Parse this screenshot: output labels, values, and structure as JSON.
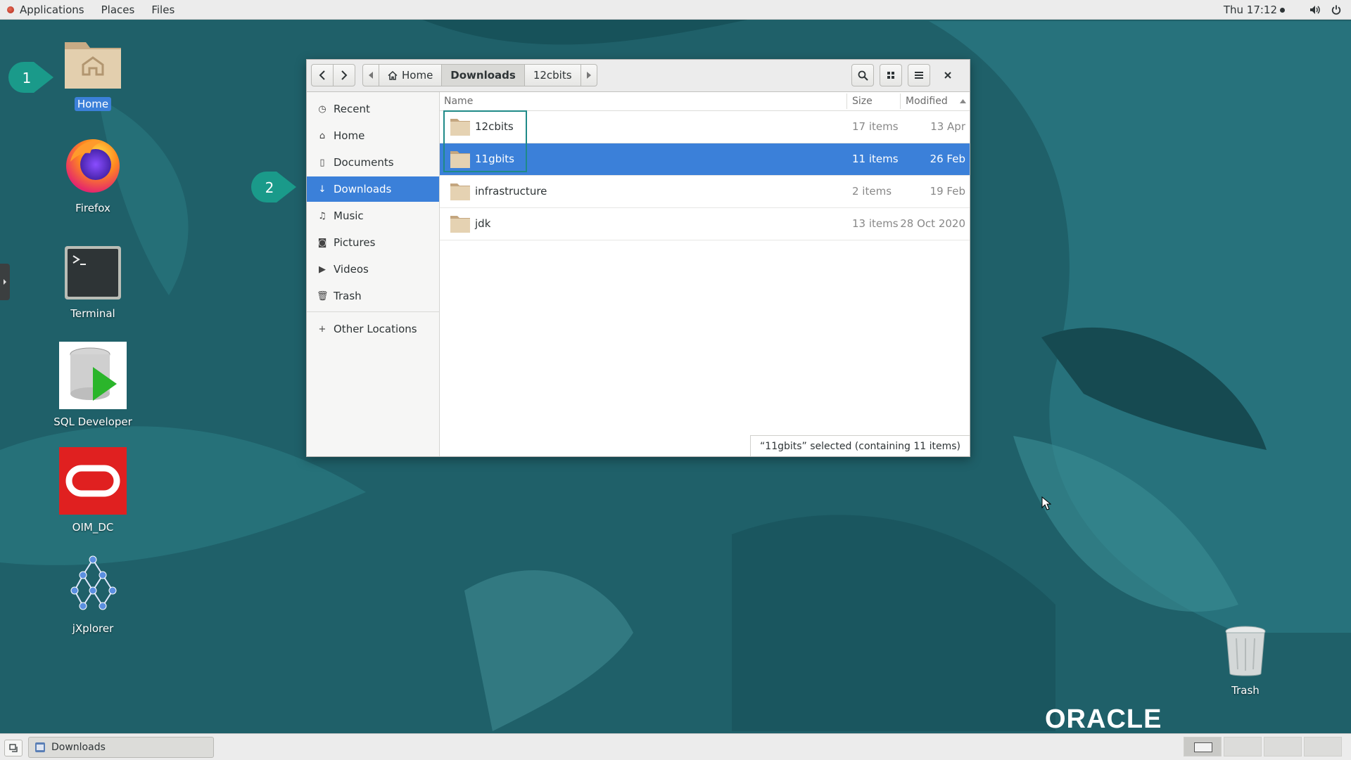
{
  "topbar": {
    "menus": [
      "Applications",
      "Places",
      "Files"
    ],
    "clock": "Thu 17:12"
  },
  "desktop": {
    "icons": [
      {
        "label": "Home",
        "selected": true
      },
      {
        "label": "Firefox"
      },
      {
        "label": "Terminal"
      },
      {
        "label": "SQL Developer"
      },
      {
        "label": "OIM_DC"
      },
      {
        "label": "jXplorer"
      },
      {
        "label": "Trash"
      }
    ],
    "callouts": [
      "1",
      "2"
    ],
    "brand": "ORACLE"
  },
  "window": {
    "breadcrumbs": [
      "Home",
      "Downloads",
      "12cbits"
    ],
    "active_crumb": "Downloads",
    "sidebar": [
      {
        "label": "Recent",
        "icon": "clock-icon"
      },
      {
        "label": "Home",
        "icon": "home-icon"
      },
      {
        "label": "Documents",
        "icon": "document-icon"
      },
      {
        "label": "Downloads",
        "icon": "download-icon",
        "selected": true
      },
      {
        "label": "Music",
        "icon": "music-icon"
      },
      {
        "label": "Pictures",
        "icon": "camera-icon"
      },
      {
        "label": "Videos",
        "icon": "video-icon"
      },
      {
        "label": "Trash",
        "icon": "trash-icon"
      },
      {
        "label": "Other Locations",
        "icon": "plus-icon"
      }
    ],
    "columns": {
      "name": "Name",
      "size": "Size",
      "modified": "Modified"
    },
    "files": [
      {
        "name": "12cbits",
        "size": "17 items",
        "modified": "13 Apr"
      },
      {
        "name": "11gbits",
        "size": "11 items",
        "modified": "26 Feb",
        "selected": true
      },
      {
        "name": "infrastructure",
        "size": "2 items",
        "modified": "19 Feb"
      },
      {
        "name": "jdk",
        "size": "13 items",
        "modified": "28 Oct 2020"
      }
    ],
    "status": "“11gbits” selected  (containing 11 items)"
  },
  "taskbar": {
    "task_label": "Downloads"
  },
  "colors": {
    "selection": "#3b80d9",
    "wallpaper": "#1e5f66",
    "callout": "#1a9a8a",
    "highlight_box": "#1f8a88"
  }
}
